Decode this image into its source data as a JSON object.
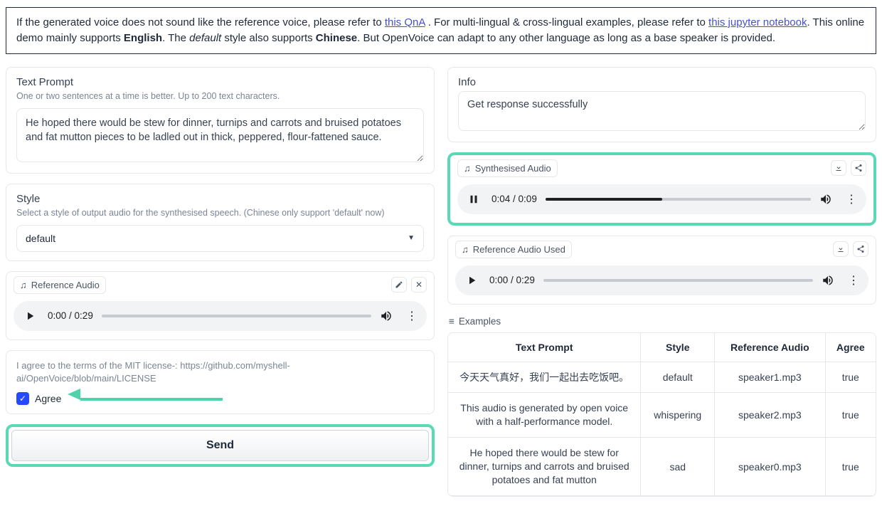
{
  "notice": {
    "part1": "If the generated voice does not sound like the reference voice, please refer to ",
    "link1": "this QnA",
    "part2": ". For multi-lingual & cross-lingual examples, please refer to ",
    "link2": "this jupyter notebook",
    "part3": ". This online demo mainly supports ",
    "bold1": "English",
    "part4": ". The ",
    "italic1": "default",
    "part5": " style also supports ",
    "bold2": "Chinese",
    "part6": ". But OpenVoice can adapt to any other language as long as a base speaker is provided."
  },
  "left": {
    "textprompt": {
      "title": "Text Prompt",
      "sub": "One or two sentences at a time is better. Up to 200 text characters.",
      "value": "He hoped there would be stew for dinner, turnips and carrots and bruised potatoes and fat mutton pieces to be ladled out in thick, peppered, flour-fattened sauce."
    },
    "style": {
      "title": "Style",
      "sub": "Select a style of output audio for the synthesised speech. (Chinese only support 'default' now)",
      "selected": "default"
    },
    "refaudio": {
      "chip": "Reference Audio",
      "time_current": "0:00",
      "time_total": "0:29",
      "progress_pct": 0
    },
    "agree": {
      "license_text": "I agree to the terms of the MIT license-: https://github.com/myshell-ai/OpenVoice/blob/main/LICENSE",
      "checkbox_label": "Agree",
      "checked": true
    },
    "send_label": "Send"
  },
  "right": {
    "info": {
      "title": "Info",
      "value": "Get response successfully"
    },
    "synth": {
      "chip": "Synthesised Audio",
      "time_current": "0:04",
      "time_total": "0:09",
      "progress_pct": 44
    },
    "refused": {
      "chip": "Reference Audio Used",
      "time_current": "0:00",
      "time_total": "0:29",
      "progress_pct": 0
    },
    "examples_header": "Examples",
    "examples": {
      "headers": [
        "Text Prompt",
        "Style",
        "Reference Audio",
        "Agree"
      ],
      "rows": [
        {
          "prompt": "今天天气真好，我们一起出去吃饭吧。",
          "style": "default",
          "ref": "speaker1.mp3",
          "agree": "true"
        },
        {
          "prompt": "This audio is generated by open voice with a half-performance model.",
          "style": "whispering",
          "ref": "speaker2.mp3",
          "agree": "true"
        },
        {
          "prompt": "He hoped there would be stew for dinner, turnips and carrots and bruised potatoes and fat mutton",
          "style": "sad",
          "ref": "speaker0.mp3",
          "agree": "true"
        }
      ]
    }
  }
}
